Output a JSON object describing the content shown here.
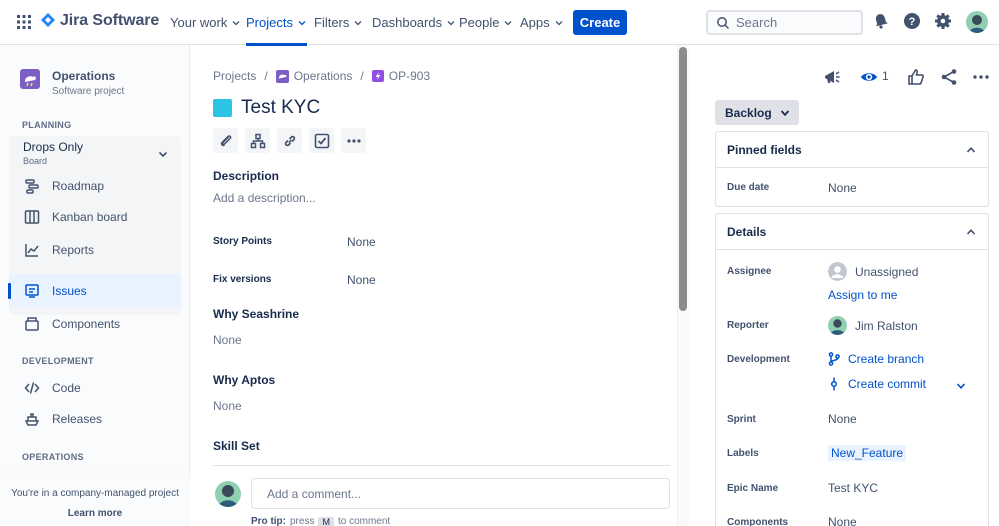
{
  "nav": {
    "logo": "Jira Software",
    "items": [
      {
        "label": "Your work"
      },
      {
        "label": "Projects"
      },
      {
        "label": "Filters"
      },
      {
        "label": "Dashboards"
      },
      {
        "label": "People"
      },
      {
        "label": "Apps"
      }
    ],
    "create": "Create",
    "search_placeholder": "Search"
  },
  "sidebar": {
    "project_name": "Operations",
    "project_type": "Software project",
    "planning_header": "PLANNING",
    "board_name": "Drops Only",
    "board_type": "Board",
    "planning_items": [
      {
        "label": "Roadmap"
      },
      {
        "label": "Kanban board"
      },
      {
        "label": "Reports"
      }
    ],
    "issues": "Issues",
    "components": "Components",
    "development_header": "DEVELOPMENT",
    "development_items": [
      {
        "label": "Code"
      },
      {
        "label": "Releases"
      }
    ],
    "operations_header": "OPERATIONS",
    "footer_text": "You're in a company-managed project",
    "footer_link": "Learn more"
  },
  "breadcrumb": {
    "projects": "Projects",
    "project": "Operations",
    "issue_key": "OP-903"
  },
  "issue": {
    "title": "Test KYC",
    "description_label": "Description",
    "description_placeholder": "Add a description...",
    "fields": [
      {
        "label": "Story Points",
        "value": "None"
      },
      {
        "label": "Fix versions",
        "value": "None"
      }
    ],
    "sections": [
      {
        "label": "Why Seashrine",
        "value": "None"
      },
      {
        "label": "Why Aptos",
        "value": "None"
      }
    ],
    "skill_set_label": "Skill Set",
    "comment_placeholder": "Add a comment...",
    "pro_tip_label": "Pro tip:",
    "pro_tip_press": "press",
    "pro_tip_key": "M",
    "pro_tip_suffix": "to comment"
  },
  "right": {
    "watch_count": "1",
    "status": "Backlog",
    "pinned_header": "Pinned fields",
    "due_date_label": "Due date",
    "due_date_value": "None",
    "details_header": "Details",
    "assignee_label": "Assignee",
    "assignee_value": "Unassigned",
    "assign_to_me": "Assign to me",
    "reporter_label": "Reporter",
    "reporter_value": "Jim Ralston",
    "development_label": "Development",
    "create_branch": "Create branch",
    "create_commit": "Create commit",
    "sprint_label": "Sprint",
    "sprint_value": "None",
    "labels_label": "Labels",
    "labels_value": "New_Feature",
    "epic_label": "Epic Name",
    "epic_value": "Test KYC",
    "components_label": "Components",
    "components_value": "None"
  },
  "colors": {
    "brand": "#0052cc",
    "issue_type": "#2bc4e3",
    "text": "#172b4d"
  }
}
